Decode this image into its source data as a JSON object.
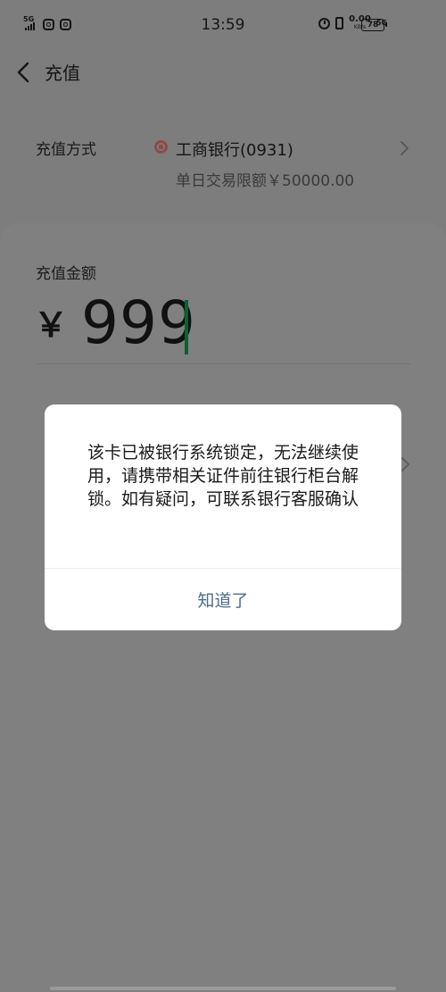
{
  "status_bar": {
    "sim_label": "5G",
    "time": "13:59",
    "net_speed": "0.00",
    "net_speed_unit": "KB/s",
    "network_type": "5G",
    "battery": "78"
  },
  "header": {
    "title": "充值"
  },
  "method": {
    "label": "充值方式",
    "bank_name": "工商银行(0931)",
    "limit": "单日交易限额￥50000.00"
  },
  "amount": {
    "label": "充值金额",
    "currency": "￥",
    "value": "999"
  },
  "dialog": {
    "message": "该卡已被银行系统锁定，无法继续使用，请携带相关证件前往银行柜台解锁。如有疑问，可联系银行客服确认",
    "button": "知道了"
  },
  "colors": {
    "overlay": "#7d7d7d",
    "dialog_button": "#4f6b8c",
    "caret": "#0c5f37",
    "bank_icon": "#8e4a4a"
  }
}
